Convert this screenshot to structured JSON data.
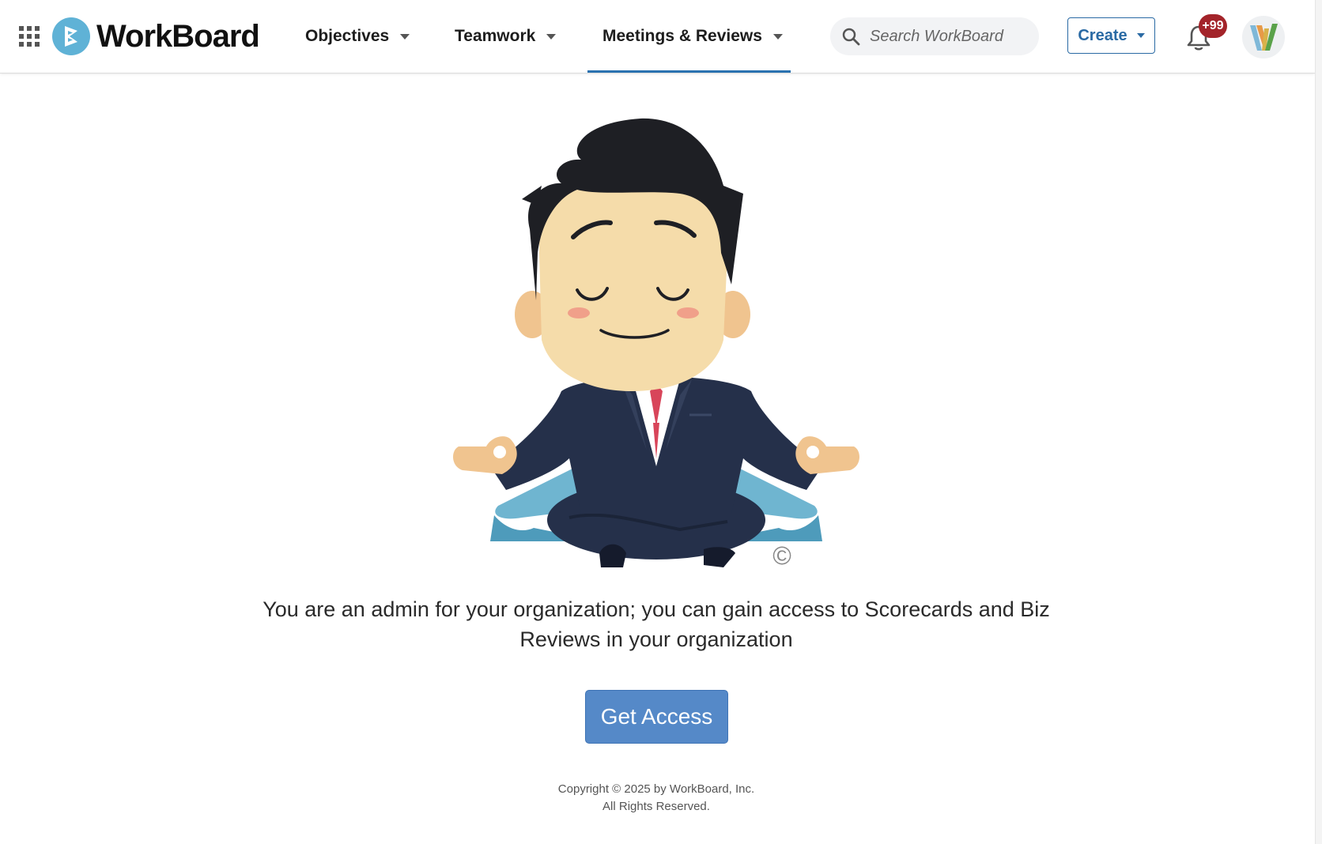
{
  "header": {
    "logo_text": "WorkBoard",
    "nav": [
      {
        "label": "Objectives"
      },
      {
        "label": "Teamwork"
      },
      {
        "label": "Meetings & Reviews",
        "active": true
      }
    ],
    "search_placeholder": "Search WorkBoard",
    "create_label": "Create",
    "notification_count": "+99"
  },
  "main": {
    "message": "You are an admin for your organization; you can gain access to Scorecards and Biz Reviews in your organization",
    "button_label": "Get Access",
    "copyright_mark": "©"
  },
  "footer": {
    "line1": "Copyright © 2025 by WorkBoard, Inc.",
    "line2": "All Rights Reserved."
  },
  "colors": {
    "accent": "#2a72b0",
    "button": "#5589c8",
    "badge": "#a3242a",
    "logo": "#5fb2d6"
  }
}
